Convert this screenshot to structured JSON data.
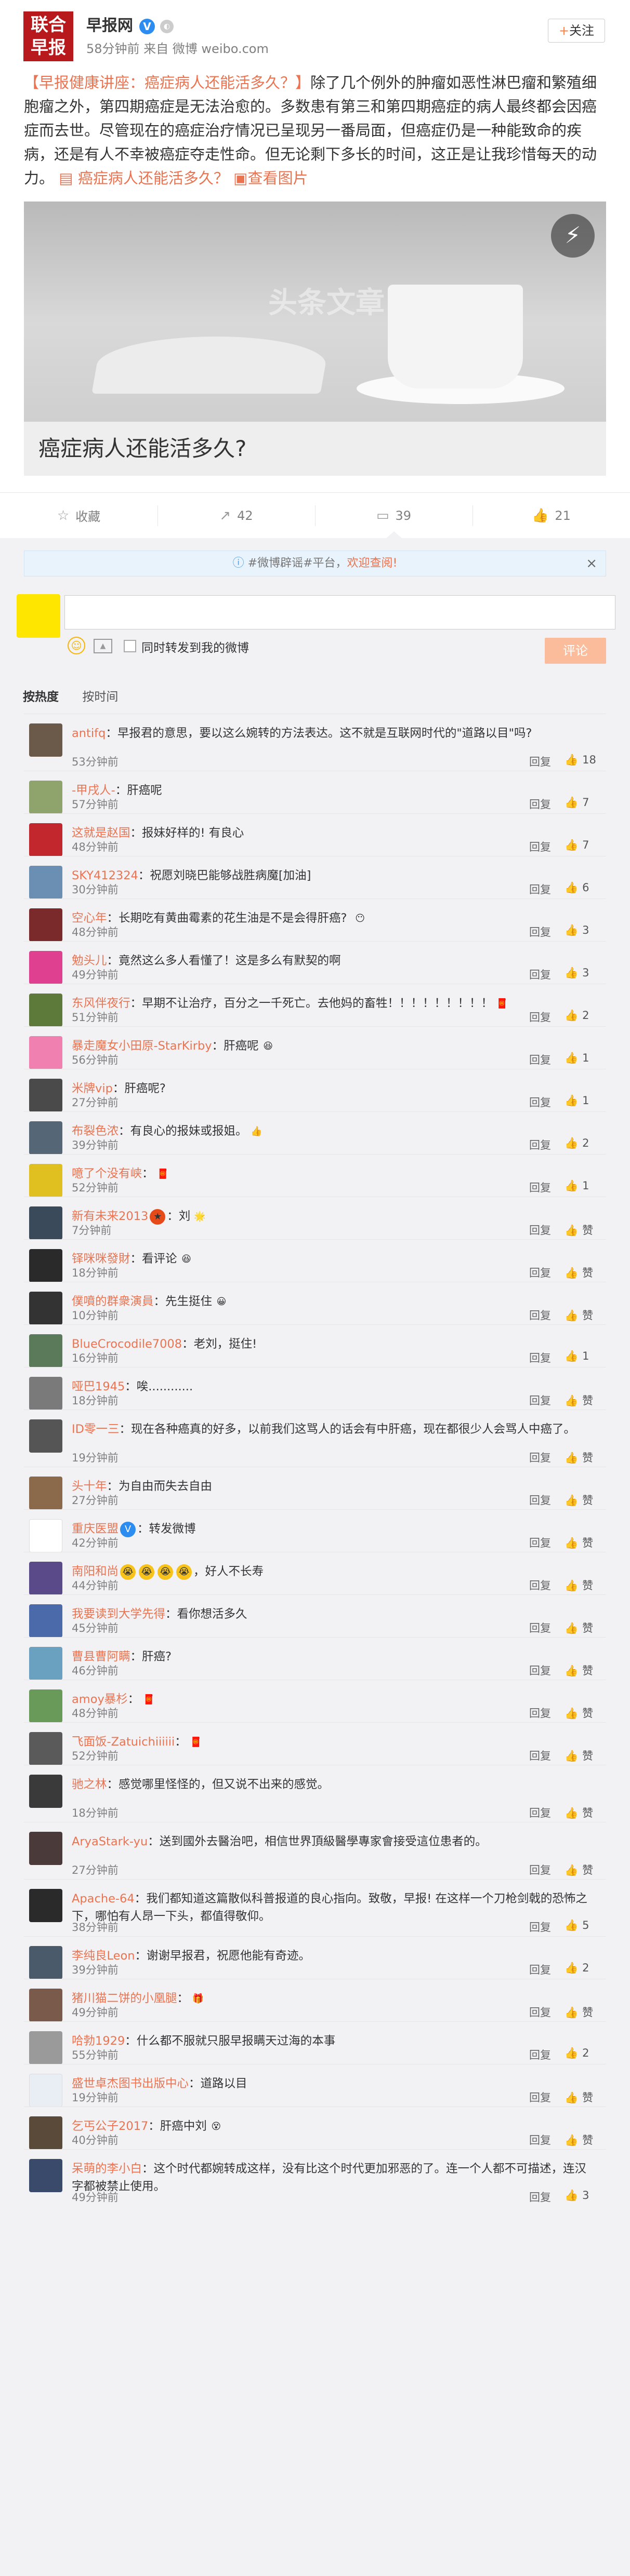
{
  "post": {
    "avatar_text": "联合\n早报",
    "author": "早报网",
    "verified_icon": "V",
    "meta": "58分钟前 来自 微博 weibo.com",
    "follow_label": "关注",
    "tag": "【早报健康讲座：癌症病人还能活多久？】",
    "body": "除了几个例外的肿瘤如恶性淋巴瘤和繁殖细胞瘤之外，第四期癌症是无法治愈的。多数患有第三和第四期癌症的病人最终都会因癌症而去世。尽管现在的癌症治疗情况已呈现另一番局面，但癌症仍是一种能致命的疾病，还是有人不幸被癌症夺走性命。但无论剩下多长的时间，这正是让我珍惜每天的动力。",
    "link_text": "癌症病人还能活多久？",
    "view_image": "查看图片",
    "article_watermark": "头条文章",
    "article_title": "癌症病人还能活多久?"
  },
  "actions": {
    "collect": "收藏",
    "repost": "42",
    "comment": "39",
    "like": "21"
  },
  "notice": {
    "text": "#微博辟谣#平台，",
    "link": "欢迎查阅!"
  },
  "composer": {
    "checkbox_label": "同时转发到我的微博",
    "submit_label": "评论"
  },
  "sort": {
    "hot": "按热度",
    "time": "按时间"
  },
  "reply_label": "回复",
  "comments": [
    {
      "user": "antifq",
      "text": "：早报君的意思，要以这么婉转的方法表达。这不就是互联网时代的\"道路以目\"吗?",
      "time": "53分钟前",
      "likes": "18",
      "color": "#6b5a4a"
    },
    {
      "user": "-甲戌人-",
      "text": "：肝癌呢",
      "time": "57分钟前",
      "likes": "7",
      "color": "#8fa36c"
    },
    {
      "user": "这就是赵国",
      "text": "：报妹好样的! 有良心",
      "time": "48分钟前",
      "likes": "7",
      "color": "#c2272d"
    },
    {
      "user": "SKY412324",
      "text": "：祝愿刘晓巴能够战胜病魔[加油]",
      "time": "30分钟前",
      "likes": "6",
      "color": "#6a8fb3"
    },
    {
      "user": "空心年",
      "text": "：长期吃有黄曲霉素的花生油是不是会得肝癌? ",
      "time": "48分钟前",
      "likes": "3",
      "color": "#7a2a2a"
    },
    {
      "user": "勉头儿",
      "text": "：竟然这么多人看懂了！这是多么有默契的啊",
      "time": "49分钟前",
      "likes": "3",
      "color": "#e04090"
    },
    {
      "user": "东风伴夜行",
      "text": "：早期不让治疗，百分之一千死亡。去他妈的畜牲！！！！！！！！！",
      "time": "51分钟前",
      "likes": "2",
      "color": "#5d7a3a"
    },
    {
      "user": "暴走魔女小田原-StarKirby",
      "text": "：肝癌呢",
      "time": "56分钟前",
      "likes": "1",
      "color": "#f080b0"
    },
    {
      "user": "米牌vip",
      "text": "：肝癌呢?",
      "time": "27分钟前",
      "likes": "1",
      "color": "#4a4a4a"
    },
    {
      "user": "布裂色浓",
      "text": "：有良心的报妹或报姐。",
      "time": "39分钟前",
      "likes": "2",
      "color": "#556677"
    },
    {
      "user": "噫了个没有峡",
      "text": "：",
      "time": "52分钟前",
      "likes": "1",
      "color": "#e0c020"
    },
    {
      "user": "新有未来2013",
      "text": "：刘",
      "time": "7分钟前",
      "likes": "赞",
      "color": "#3a4a5a"
    },
    {
      "user": "铎咪咪發財",
      "text": "：看评论",
      "time": "18分钟前",
      "likes": "赞",
      "color": "#2a2a2a"
    },
    {
      "user": "僕噴的群衆演員",
      "text": "：先生挺住",
      "time": "10分钟前",
      "likes": "赞",
      "color": "#333333"
    },
    {
      "user": "BlueCrocodile7008",
      "text": "：老刘，挺住!",
      "time": "16分钟前",
      "likes": "1",
      "color": "#5a7a5a"
    },
    {
      "user": "哑巴1945",
      "text": "：唉............",
      "time": "18分钟前",
      "likes": "赞",
      "color": "#7a7a7a"
    },
    {
      "user": "ID零一三",
      "text": "：现在各种癌真的好多，以前我们这骂人的话会有中肝癌，现在都很少人会骂人中癌了。",
      "time": "19分钟前",
      "likes": "赞",
      "color": "#555555"
    },
    {
      "user": "头十年",
      "text": "：为自由而失去自由",
      "time": "27分钟前",
      "likes": "赞",
      "color": "#8a6a4a"
    },
    {
      "user": "重庆医盟",
      "text": "：转发微博",
      "time": "42分钟前",
      "likes": "赞",
      "color": "#ffffff"
    },
    {
      "user": "南阳和尚",
      "text": "，好人不长寿",
      "time": "44分钟前",
      "likes": "赞",
      "color": "#5a4a8a"
    },
    {
      "user": "我要读到大学先得",
      "text": "：看你想活多久",
      "time": "45分钟前",
      "likes": "赞",
      "color": "#4a6aaa"
    },
    {
      "user": "曹县曹阿瞒",
      "text": "：肝癌?",
      "time": "46分钟前",
      "likes": "赞",
      "color": "#6aa0c0"
    },
    {
      "user": "amoy暴杉",
      "text": "：",
      "time": "48分钟前",
      "likes": "赞",
      "color": "#6a9a5a"
    },
    {
      "user": "飞面饭-Zatuichiiiiii",
      "text": "：",
      "time": "52分钟前",
      "likes": "赞",
      "color": "#5a5a5a"
    },
    {
      "user": "驰之林",
      "text": "：感觉哪里怪怪的，但又说不出来的感觉。",
      "time": "18分钟前",
      "likes": "赞",
      "color": "#3a3a3a"
    },
    {
      "user": "AryaStark-yu",
      "text": "：送到國外去醫治吧，相信世界頂級醫學專家會接受這位患者的。",
      "time": "27分钟前",
      "likes": "赞",
      "color": "#4a3a3a"
    },
    {
      "user": "Apache-64",
      "text": "：我们都知道这篇散似科普报道的良心指向。致敬，早报! 在这样一个刀枪剑戟的恐怖之下，哪怕有人昂一下头，都值得敬仰。",
      "time": "38分钟前",
      "likes": "5",
      "color": "#2a2a2a"
    },
    {
      "user": "李纯良Leon",
      "text": "：谢谢早报君，祝愿他能有奇迹。",
      "time": "39分钟前",
      "likes": "2",
      "color": "#4a5a6a"
    },
    {
      "user": "猪川猫二饼的小凰腿",
      "text": "：",
      "time": "49分钟前",
      "likes": "赞",
      "color": "#7a5a4a"
    },
    {
      "user": "哈勃1929",
      "text": "：什么都不服就只服早报瞒天过海的本事",
      "time": "55分钟前",
      "likes": "2",
      "color": "#9a9a9a"
    },
    {
      "user": "盛世卓杰图书出版中心",
      "text": "：道路以目",
      "time": "19分钟前",
      "likes": "赞",
      "color": "#e8eef4"
    },
    {
      "user": "乞丐公子2017",
      "text": "：肝癌中刘",
      "time": "40分钟前",
      "likes": "赞",
      "color": "#5a4a3a"
    },
    {
      "user": "呆萌的李小白",
      "text": "：这个时代都婉转成这样，没有比这个时代更加邪恶的了。连一个人都不可描述，连汉字都被禁止使用。",
      "time": "49分钟前",
      "likes": "3",
      "color": "#3a4a6a"
    }
  ]
}
